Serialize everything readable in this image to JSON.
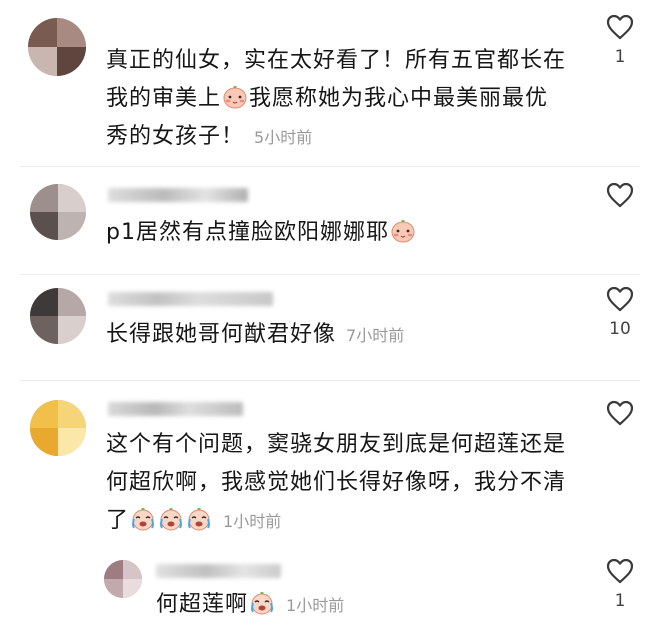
{
  "comments": [
    {
      "text_parts": [
        "真正的仙女，实在太好看了！所有五官都长在我的审美上",
        "我愿称她为我心中最美丽最优秀的女孩子！"
      ],
      "emoji_icon": "blush-face-emoji",
      "time": "5小时前",
      "likes": "1",
      "avatar_colors": [
        "#7a5b52",
        "#a88a82",
        "#c9b6b0",
        "#5e463f"
      ]
    },
    {
      "text_parts": [
        "p1居然有点撞脸欧阳娜娜耶"
      ],
      "emoji_icon": "blush-face-emoji",
      "time": "",
      "likes": "",
      "avatar_colors": [
        "#9c8f8c",
        "#d8cfcc",
        "#5a504e",
        "#bdb3b1"
      ]
    },
    {
      "text_parts": [
        "长得跟她哥何猷君好像"
      ],
      "time": "7小时前",
      "likes": "10",
      "avatar_colors": [
        "#3f3a3a",
        "#b6a8a6",
        "#6e625f",
        "#d9cfcd"
      ]
    },
    {
      "text_parts": [
        "这个有个问题，窦骁女朋友到底是何超莲还是何超欣啊，我感觉她们长得好像呀，我分不清了"
      ],
      "emoji_icon": "crying-laughing-emoji",
      "emoji_count": 3,
      "time": "1小时前",
      "likes": "",
      "avatar_colors": [
        "#f1c04a",
        "#f6d57a",
        "#e8a92e",
        "#fbe7a8"
      ]
    },
    {
      "text_parts": [
        "何超莲啊"
      ],
      "emoji_icon": "crying-laughing-emoji",
      "time": "1小时前",
      "likes": "1",
      "avatar_colors": [
        "#9e7d82",
        "#d7c4c7",
        "#c2a9ad",
        "#e8dcde"
      ]
    }
  ],
  "colors": {
    "text": "#161616",
    "time": "#9a9a9a",
    "like_icon": "#3a3a3a"
  }
}
